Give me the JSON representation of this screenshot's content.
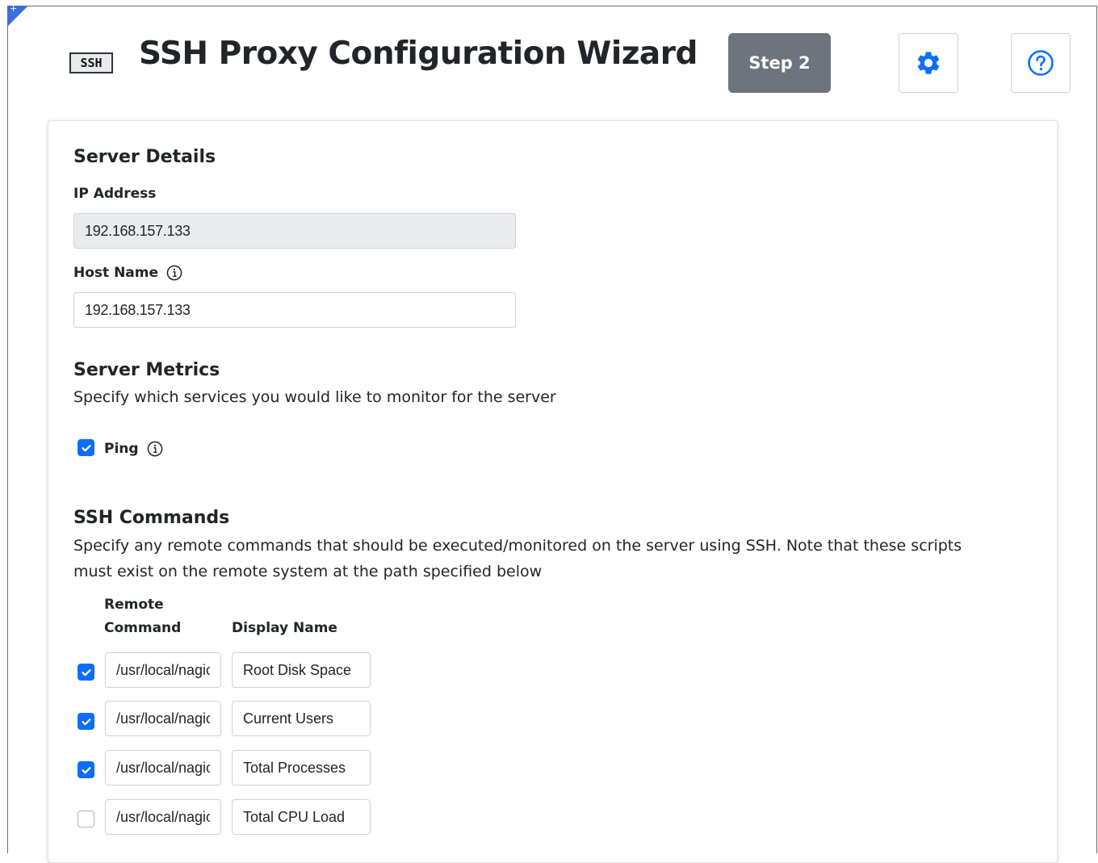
{
  "header": {
    "logo_text": "SSH",
    "title": "SSH Proxy Configuration Wizard",
    "step_label": "Step 2",
    "settings_icon": "gear-icon",
    "help_icon": "question-circle-icon"
  },
  "server_details": {
    "heading": "Server Details",
    "ip_label": "IP Address",
    "ip_value": "192.168.157.133",
    "host_label": "Host Name",
    "host_value": "192.168.157.133"
  },
  "server_metrics": {
    "heading": "Server Metrics",
    "description": "Specify which services you would like to monitor for the server",
    "ping_label": "Ping",
    "ping_checked": true
  },
  "ssh_commands": {
    "heading": "SSH Commands",
    "description": "Specify any remote commands that should be executed/monitored on the server using SSH. Note that these scripts must exist on the remote system at the path specified below",
    "col_remote_command": "Remote Command",
    "col_display_name": "Display Name",
    "rows": [
      {
        "checked": true,
        "command": "/usr/local/nagios/libexec/check_disk",
        "display_name": "Root Disk Space"
      },
      {
        "checked": true,
        "command": "/usr/local/nagios/libexec/check_users",
        "display_name": "Current Users"
      },
      {
        "checked": true,
        "command": "/usr/local/nagios/libexec/check_procs",
        "display_name": "Total Processes"
      },
      {
        "checked": false,
        "command": "/usr/local/nagios/libexec/check_load",
        "display_name": "Total CPU Load"
      }
    ]
  },
  "colors": {
    "accent": "#0d6efd",
    "step_badge": "#6c757d",
    "readonly_bg": "#e9ecef"
  }
}
